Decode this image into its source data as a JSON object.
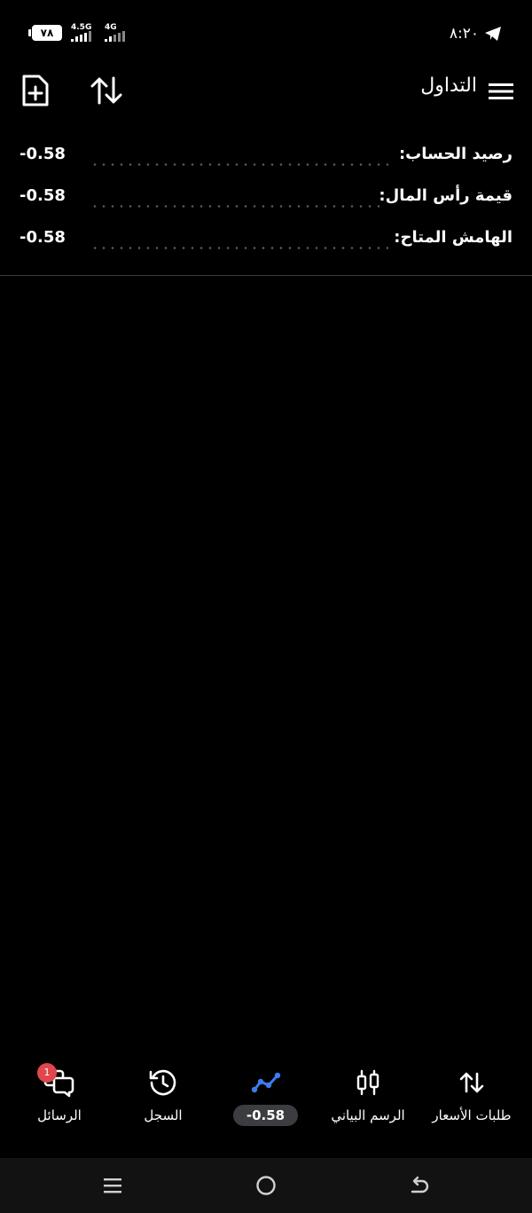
{
  "status_bar": {
    "battery_level": "٧٨",
    "network_1": "4.5G",
    "network_2": "4G",
    "time": "٨:٢٠",
    "telegram_icon": "paper-plane-icon"
  },
  "app_bar": {
    "title": "التداول",
    "menu_icon": "hamburger-menu-icon",
    "new_order_icon": "new-document-icon",
    "sort_icon": "sort-arrows-icon"
  },
  "account_summary": [
    {
      "label": "رصيد الحساب:",
      "value": "-0.58"
    },
    {
      "label": "قيمة رأس المال:",
      "value": "-0.58"
    },
    {
      "label": "الهامش المتاح:",
      "value": "-0.58"
    }
  ],
  "bottom_nav": {
    "items": [
      {
        "label": "طلبات الأسعار",
        "icon": "up-down-arrows-icon"
      },
      {
        "label": "الرسم البياني",
        "icon": "candlestick-icon"
      },
      {
        "label": "-0.58",
        "icon": "trend-line-icon",
        "active": true
      },
      {
        "label": "السجل",
        "icon": "history-clock-icon"
      },
      {
        "label": "الرسائل",
        "icon": "chat-bubbles-icon",
        "badge": "1"
      }
    ]
  },
  "colors": {
    "background": "#000000",
    "text": "#ffffff",
    "accent": "#3d7cf0",
    "badge": "#e0474c",
    "pill": "#3c3d40",
    "divider": "#3a3a3a",
    "system_nav": "#121212"
  }
}
